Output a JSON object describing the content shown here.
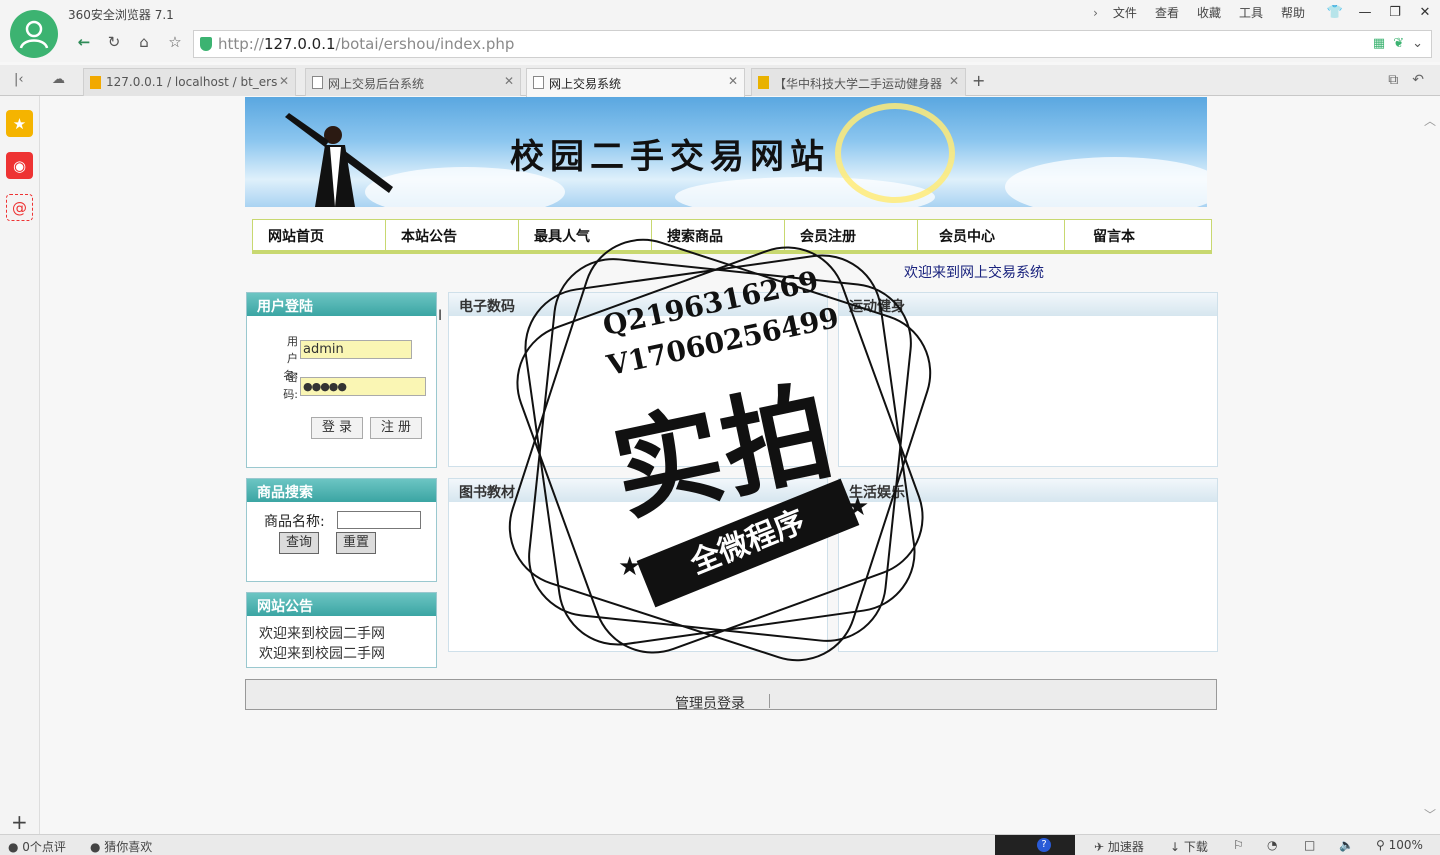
{
  "browser": {
    "title": "360安全浏览器 7.1",
    "menu": [
      "文件",
      "查看",
      "收藏",
      "工具",
      "帮助"
    ],
    "url_prefix": "http://",
    "url_host": "127.0.0.1",
    "url_path": "/botai/ershou/index.php"
  },
  "tabs": [
    {
      "label": "127.0.0.1 / localhost / bt_ers"
    },
    {
      "label": "网上交易后台系统"
    },
    {
      "label": "网上交易系统"
    },
    {
      "label": "【华中科技大学二手运动健身器"
    }
  ],
  "banner": {
    "title": "校园二手交易网站"
  },
  "nav": [
    "网站首页",
    "本站公告",
    "最具人气",
    "搜索商品",
    "会员注册",
    "会员中心",
    "留言本"
  ],
  "welcome": "欢迎来到网上交易系统",
  "login": {
    "header": "用户登陆",
    "username_label_1": "用户",
    "username_label_2": "名:",
    "password_label_1": "密",
    "password_label_2": "码:",
    "username_value": "admin",
    "password_value": "●●●●●",
    "login_button": "登 录",
    "register_button": "注 册"
  },
  "search": {
    "header": "商品搜索",
    "label": "商品名称:",
    "query_button": "查询",
    "reset_button": "重置"
  },
  "notice": {
    "header": "网站公告",
    "items": [
      "欢迎来到校园二手网",
      "欢迎来到校园二手网"
    ]
  },
  "categories": [
    "电子数码",
    "运动健身",
    "图书教材",
    "生活娱乐"
  ],
  "footer": {
    "admin_login": "管理员登录"
  },
  "watermark": {
    "qq": "Q2196316269",
    "vx": "V17060256499",
    "big": "实拍",
    "ribbon": "全微程序"
  },
  "statusbar": {
    "comments": "0个点评",
    "guess": "猜你喜欢",
    "accelerator": "加速器",
    "download": "下载",
    "zoom": "100%"
  },
  "colors": {
    "box_header": "#3ba5a3",
    "nav_border": "#c8d870",
    "welcome_text": "#1a237e",
    "input_fill": "#faf6b4"
  }
}
